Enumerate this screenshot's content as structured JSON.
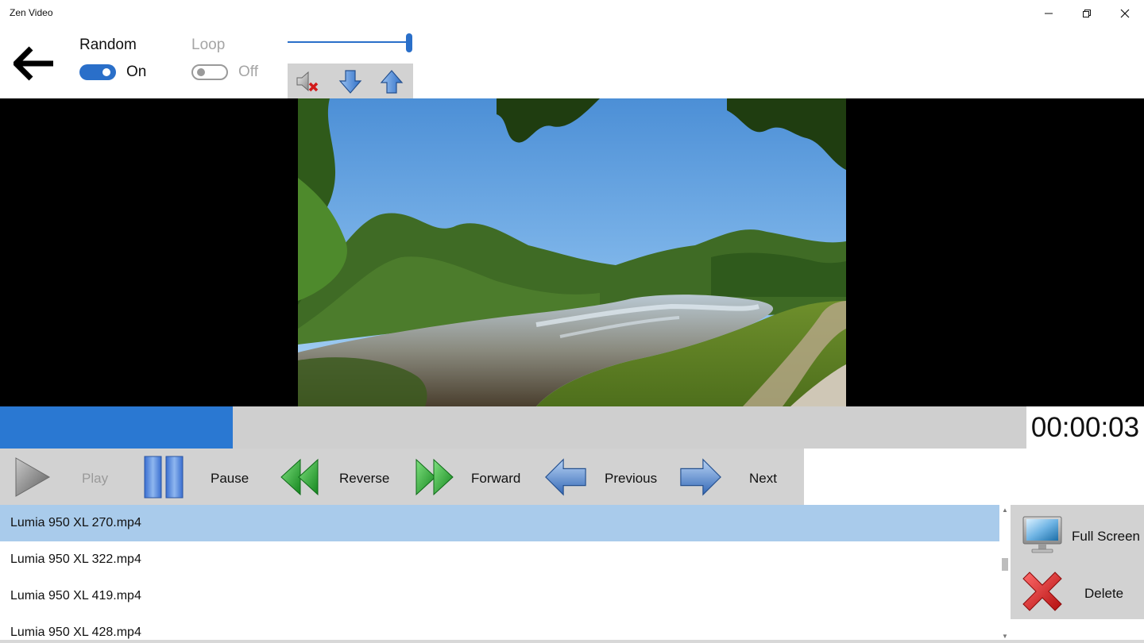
{
  "window": {
    "title": "Zen Video",
    "controls": [
      "minimize-icon",
      "restore-icon",
      "close-icon"
    ]
  },
  "toolbar": {
    "back_icon": "arrow-left-icon",
    "random": {
      "label": "Random",
      "state": "On",
      "enabled": true
    },
    "loop": {
      "label": "Loop",
      "state": "Off",
      "enabled": false
    },
    "volume": {
      "level_fraction": 1.0,
      "buttons": [
        "mute-icon",
        "volume-down-icon",
        "volume-up-icon"
      ]
    }
  },
  "player": {
    "progress_fraction": 0.227,
    "time": "00:00:03"
  },
  "controls": [
    {
      "id": "play",
      "label": "Play",
      "icon": "play-icon",
      "enabled": false
    },
    {
      "id": "pause",
      "label": "Pause",
      "icon": "pause-icon",
      "enabled": true
    },
    {
      "id": "reverse",
      "label": "Reverse",
      "icon": "rewind-icon",
      "enabled": true
    },
    {
      "id": "forward",
      "label": "Forward",
      "icon": "fast-forward-icon",
      "enabled": true
    },
    {
      "id": "previous",
      "label": "Previous",
      "icon": "arrow-left-icon",
      "enabled": true
    },
    {
      "id": "next",
      "label": "Next",
      "icon": "arrow-right-icon",
      "enabled": true
    }
  ],
  "files": [
    {
      "name": "Lumia 950 XL 270.mp4",
      "selected": true
    },
    {
      "name": "Lumia 950 XL 322.mp4",
      "selected": false
    },
    {
      "name": "Lumia 950 XL 419.mp4",
      "selected": false
    },
    {
      "name": "Lumia 950 XL 428.mp4",
      "selected": false
    }
  ],
  "side_actions": {
    "fullscreen": {
      "label": "Full Screen",
      "icon": "monitor-icon"
    },
    "delete": {
      "label": "Delete",
      "icon": "red-x-icon"
    }
  },
  "colors": {
    "accent": "#2a6fc9",
    "progress": "#2a78d2",
    "selection": "#a9cbeb",
    "panel": "#d2d2d2"
  }
}
